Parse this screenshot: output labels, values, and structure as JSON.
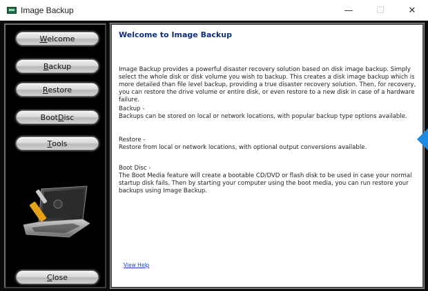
{
  "window": {
    "title": "Image Backup",
    "minimize_glyph": "—",
    "maximize_glyph": "☐",
    "close_glyph": "✕"
  },
  "sidebar": {
    "buttons": [
      {
        "id": "welcome",
        "pre": "",
        "accel": "W",
        "post": "elcome"
      },
      {
        "id": "backup",
        "pre": "",
        "accel": "B",
        "post": "ackup"
      },
      {
        "id": "restore",
        "pre": "",
        "accel": "R",
        "post": "estore"
      },
      {
        "id": "bootdisc",
        "pre": "Boot ",
        "accel": "D",
        "post": "isc"
      },
      {
        "id": "tools",
        "pre": "",
        "accel": "T",
        "post": "ools"
      },
      {
        "id": "close",
        "pre": "",
        "accel": "C",
        "post": "lose"
      }
    ],
    "illustration_icon": "laptop-with-tools-icon"
  },
  "content": {
    "title": "Welcome to Image Backup",
    "intro": "Image Backup provides a powerful disaster recovery solution based on disk image backup. Simply select the whole disk or disk volume you wish to backup. This creates a disk image backup which is more detailed than file level backup, providing a true disaster recovery solution. Then, for recovery, you can restore the drive volume or entire disk, or even restore to a new disk in case of a hardware failure.",
    "backup_heading": "Backup -",
    "backup_text": "Backups can be stored on local or network locations, with popular backup type options available.",
    "restore_heading": "Restore -",
    "restore_text": "Restore from local or network locations, with optional output conversions available.",
    "boot_heading": "Boot Disc -",
    "boot_text": "The Boot Media feature will create a bootable CD/DVD or flash disk to be used in case your normal startup disk fails. Then by starting your computer using the boot media, you can run restore your backups using Image Backup.",
    "view_help": "View Help"
  },
  "colors": {
    "frame_bg": "#0a0a0a",
    "title_blue": "#0f2f7a",
    "link_blue": "#1a3ecf",
    "accent_marker": "#1b8ae0"
  }
}
